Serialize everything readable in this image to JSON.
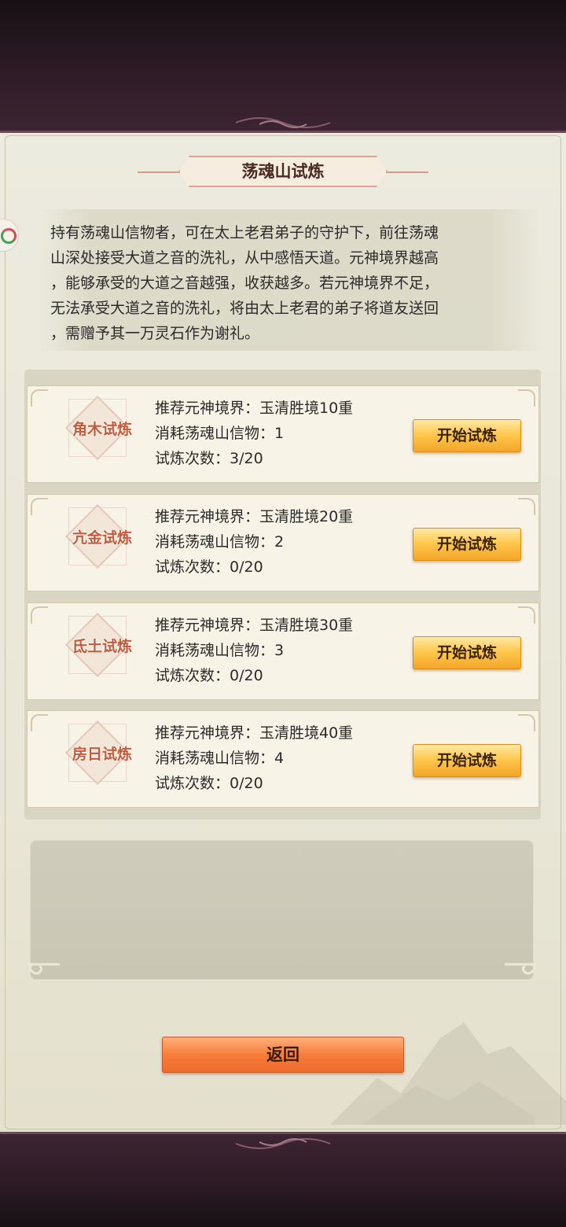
{
  "title": "荡魂山试炼",
  "description": "持有荡魂山信物者，可在太上老君弟子的守护下，前往荡魂山深处接受大道之音的洗礼，从中感悟天道。元神境界越高，能够承受的大道之音越强，收获越多。若元神境界不足，无法承受大道之音的洗礼，将由太上老君的弟子将道友送回，需赠予其一万灵石作为谢礼。",
  "description_lines": [
    "持有荡魂山信物者，可在太上老君弟子的守护下，前往荡魂",
    "山深处接受大道之音的洗礼，从中感悟天道。元神境界越高",
    "，能够承受的大道之音越强，收获越多。若元神境界不足，",
    "无法承受大道之音的洗礼，将由太上老君的弟子将道友送回",
    "，需赠予其一万灵石作为谢礼。"
  ],
  "trials": [
    {
      "name": "角木试炼",
      "recommend": "推荐元神境界：玉清胜境10重",
      "cost": "消耗荡魂山信物：1",
      "attempts": "试炼次数：3/20",
      "button": "开始试炼"
    },
    {
      "name": "亢金试炼",
      "recommend": "推荐元神境界：玉清胜境20重",
      "cost": "消耗荡魂山信物：2",
      "attempts": "试炼次数：0/20",
      "button": "开始试炼"
    },
    {
      "name": "氐土试炼",
      "recommend": "推荐元神境界：玉清胜境30重",
      "cost": "消耗荡魂山信物：3",
      "attempts": "试炼次数：0/20",
      "button": "开始试炼"
    },
    {
      "name": "房日试炼",
      "recommend": "推荐元神境界：玉清胜境40重",
      "cost": "消耗荡魂山信物：4",
      "attempts": "试炼次数：0/20",
      "button": "开始试炼"
    }
  ],
  "back_button": "返回",
  "colors": {
    "primary_button": "#ffc94e",
    "back_button": "#f77d3c",
    "frame": "#3a2330"
  },
  "icons": {
    "side": "app-badge-icon"
  }
}
